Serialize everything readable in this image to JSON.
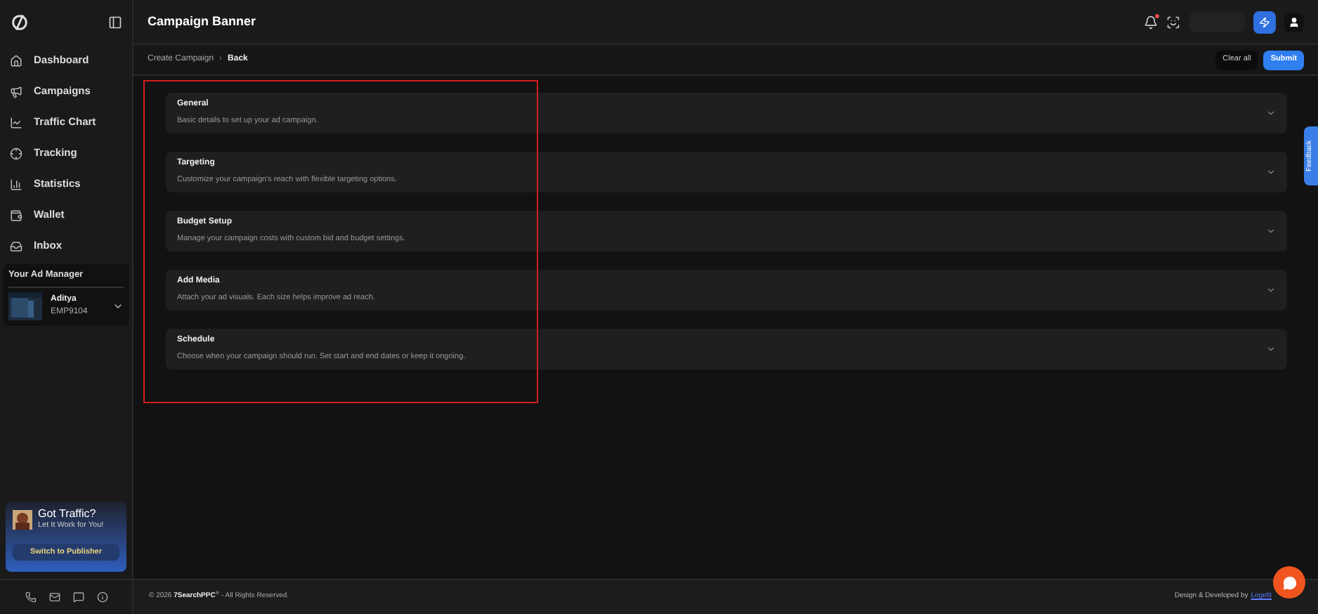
{
  "header": {
    "title": "Campaign Banner",
    "notification_unread": true
  },
  "sidebar": {
    "items": [
      {
        "label": "Dashboard",
        "selected": false
      },
      {
        "label": "Campaigns",
        "selected": false
      },
      {
        "label": "Traffic Chart",
        "selected": false
      },
      {
        "label": "Tracking",
        "selected": false
      },
      {
        "label": "Statistics",
        "selected": false
      },
      {
        "label": "Wallet",
        "selected": false
      },
      {
        "label": "Inbox",
        "selected": false
      }
    ],
    "ad_manager": {
      "title": "Your Ad Manager",
      "name": "Aditya",
      "id": "EMP9104"
    },
    "promo": {
      "title": "Got Traffic?",
      "subtitle": "Let It Work for You!",
      "button": "Switch to Publisher"
    }
  },
  "breadcrumb": {
    "items": [
      "Create Campaign",
      "Back"
    ],
    "separator": "›"
  },
  "actions": {
    "clear": "Clear all",
    "submit": "Submit"
  },
  "sections": [
    {
      "title": "General",
      "description": "Basic details to set up your ad campaign.",
      "expanded": false
    },
    {
      "title": "Targeting",
      "description": "Customize your campaign's reach with flexible targeting options.",
      "expanded": false
    },
    {
      "title": "Budget Setup",
      "description": "Manage your campaign costs with custom bid and budget settings.",
      "expanded": false
    },
    {
      "title": "Add Media",
      "description": "Attach your ad visuals. Each size helps improve ad reach.",
      "expanded": false
    },
    {
      "title": "Schedule",
      "description": "Choose when your campaign should run. Set start and end dates or keep it ongoing.",
      "expanded": false
    }
  ],
  "feedback": "Feedback",
  "footer": {
    "copyright": "© 2026 **7SearchPPC**$^{®}$ - All Rights Reserved.",
    "credit": "Design & Developed by",
    "credit_link": "Logelit"
  }
}
